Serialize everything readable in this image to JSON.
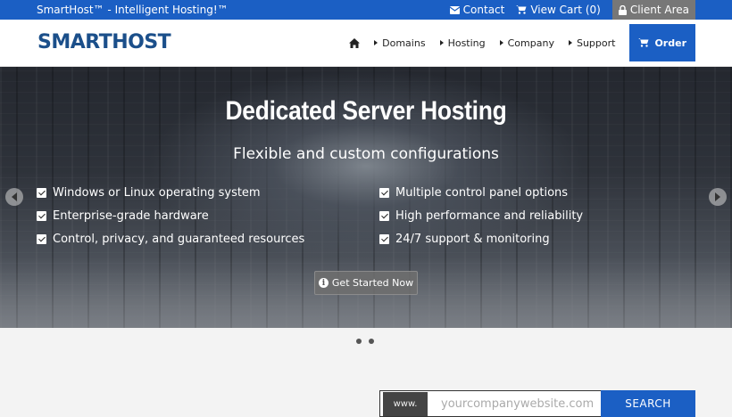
{
  "topbar": {
    "tagline": "SmartHost™ - Intelligent Hosting!™",
    "contact": "Contact",
    "cart": "View Cart (0)",
    "client_area": "Client Area"
  },
  "header": {
    "logo": "SMARTHOST",
    "nav": {
      "domains": "Domains",
      "hosting": "Hosting",
      "company": "Company",
      "support": "Support",
      "order": "Order"
    }
  },
  "hero": {
    "title": "Dedicated Server Hosting",
    "subtitle": "Flexible and custom configurations",
    "features_left": [
      "Windows or Linux operating system",
      "Enterprise-grade hardware",
      "Control, privacy, and guaranteed resources"
    ],
    "features_right": [
      "Multiple control panel options",
      "High performance and reliability",
      "24/7 support & monitoring"
    ],
    "cta": "Get Started Now"
  },
  "domain_search": {
    "prefix": "www.",
    "placeholder": "yourcompanywebsite.com",
    "button": "SEARCH"
  },
  "colors": {
    "brand_blue": "#1b5fc4",
    "logo_blue": "#1b4f8a"
  }
}
